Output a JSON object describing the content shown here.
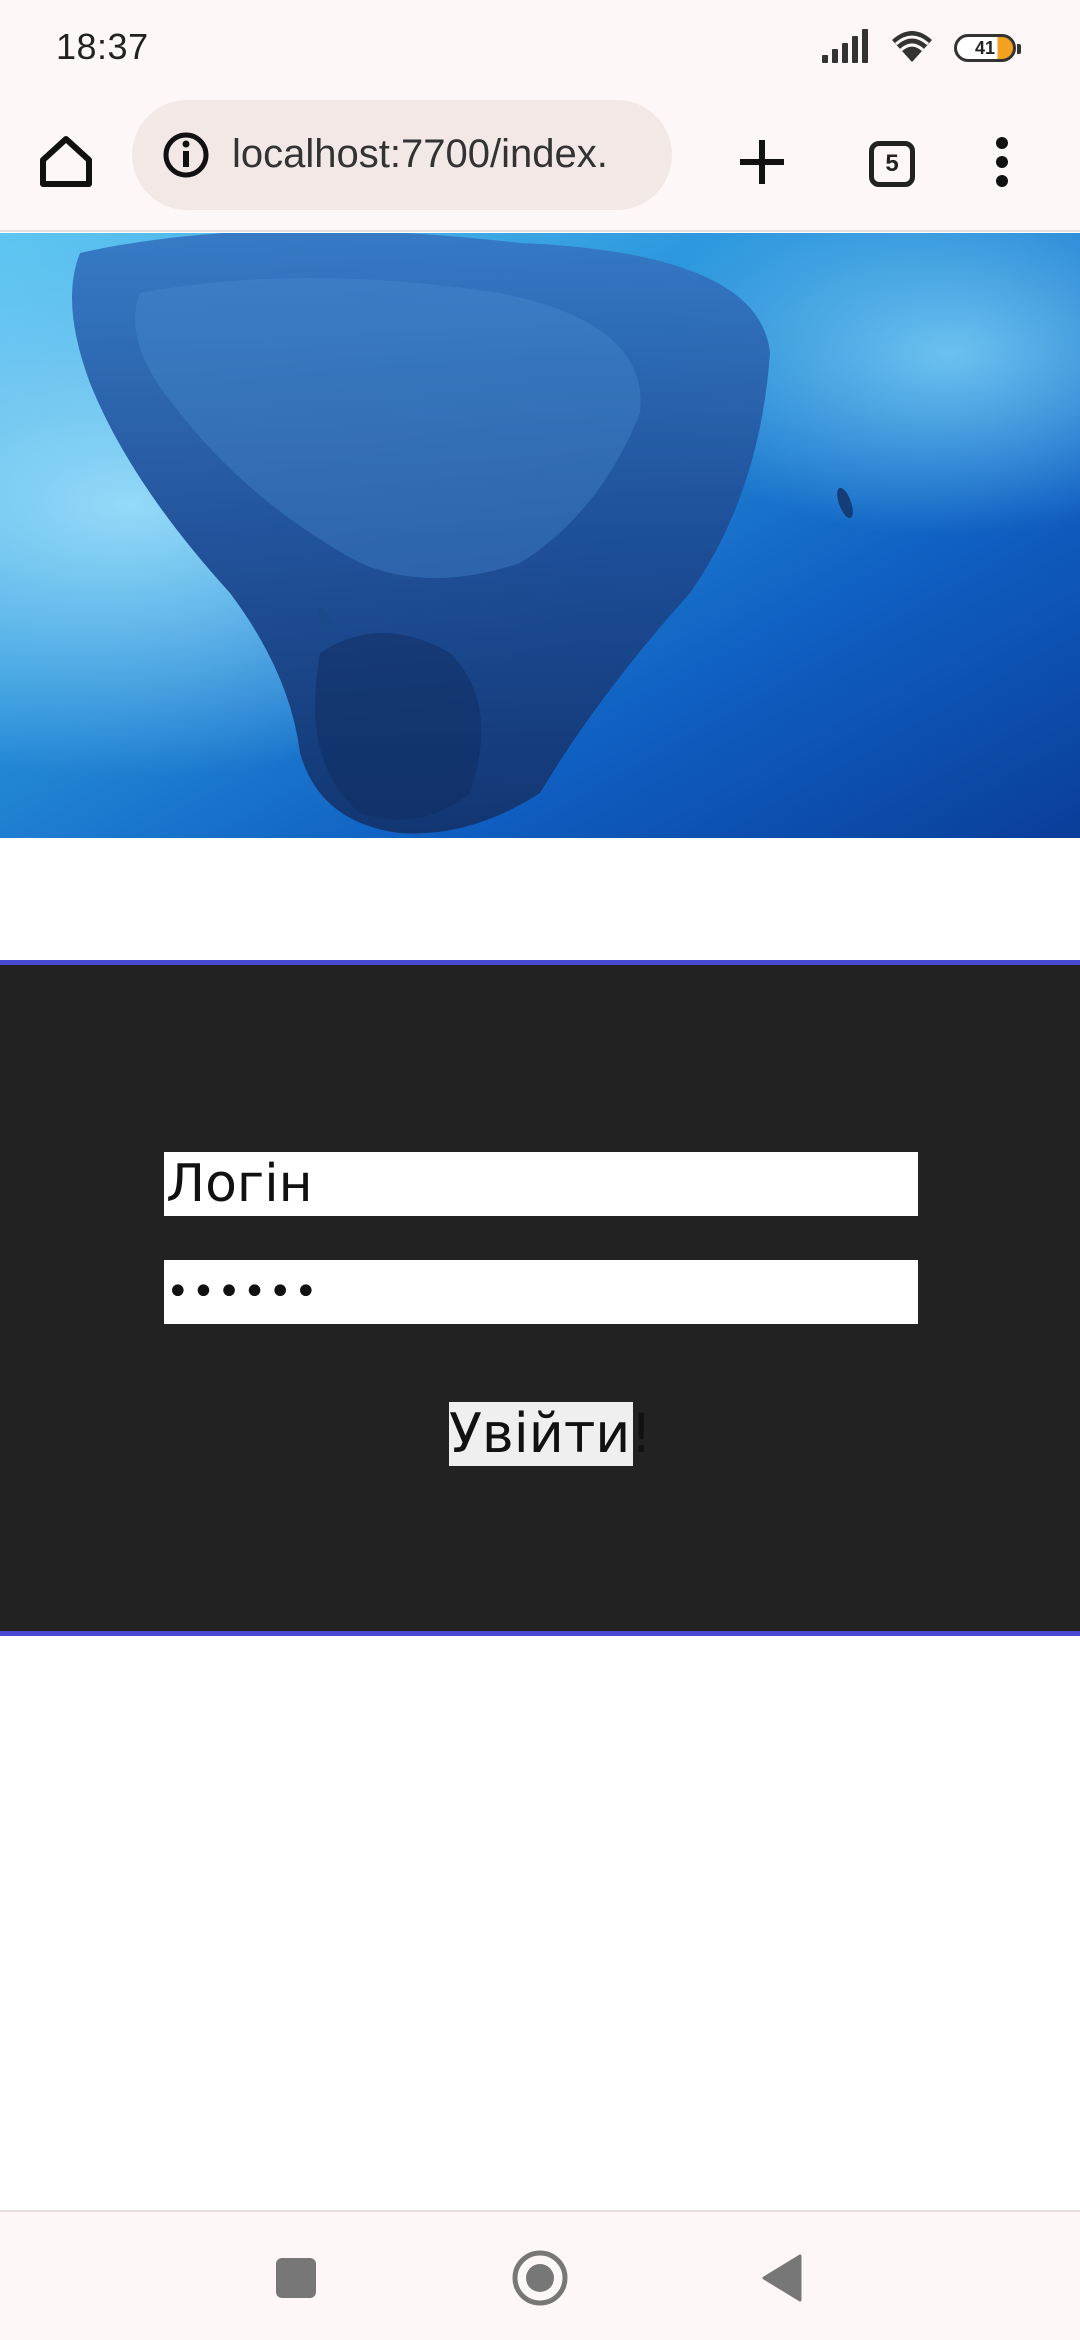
{
  "status_bar": {
    "time": "18:37",
    "battery_level": "41",
    "icons": [
      "signal-icon",
      "wifi-icon",
      "battery-icon"
    ]
  },
  "browser": {
    "url": "localhost:7700/index.",
    "tab_count": "5",
    "icons": [
      "home-icon",
      "site-info-icon",
      "new-tab-icon",
      "tab-switcher-icon",
      "more-menu-icon"
    ]
  },
  "hero": {
    "description_icon": "fish-school-image"
  },
  "login": {
    "login_value": "Логін",
    "password_value": "••••••",
    "submit_label": "Увійти!"
  },
  "colors": {
    "section_bg": "#222222",
    "section_border": "#4848d0",
    "chrome_bg": "#fdf8f7"
  },
  "nav_bar": {
    "icons": [
      "recents-icon",
      "home-circle-icon",
      "back-icon"
    ]
  }
}
